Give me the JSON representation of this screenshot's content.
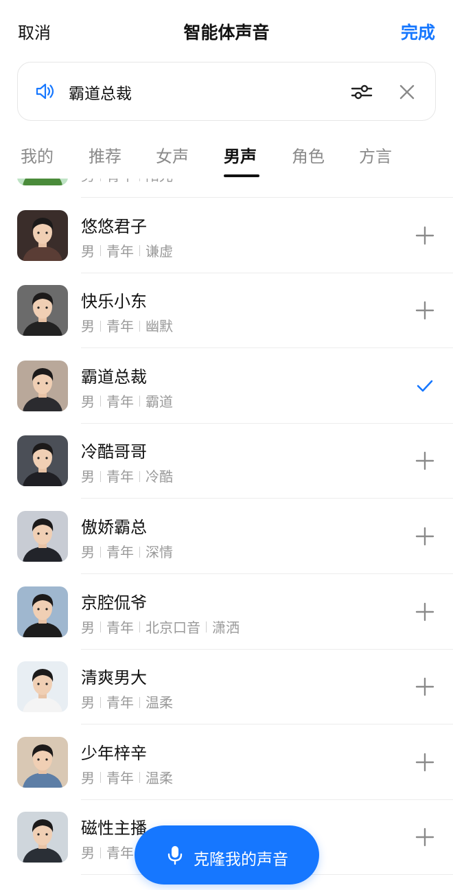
{
  "header": {
    "cancel_label": "取消",
    "title": "智能体声音",
    "done_label": "完成"
  },
  "selected_voice": {
    "name": "霸道总裁",
    "icons": [
      "speaker-icon",
      "sliders-icon",
      "close-icon"
    ]
  },
  "tabs": [
    {
      "label": "我的",
      "active": false
    },
    {
      "label": "推荐",
      "active": false
    },
    {
      "label": "女声",
      "active": false
    },
    {
      "label": "男声",
      "active": true
    },
    {
      "label": "角色",
      "active": false
    },
    {
      "label": "方言",
      "active": false
    }
  ],
  "voices": [
    {
      "name": "",
      "tags": [
        "男",
        "青年",
        "阳光"
      ],
      "selected": false,
      "avatar_bg": "#bfe3c5",
      "avatar_shirt": "#4a8b3a"
    },
    {
      "name": "悠悠君子",
      "tags": [
        "男",
        "青年",
        "谦虚"
      ],
      "selected": false,
      "avatar_bg": "#3a2d2a",
      "avatar_shirt": "#5a3d35"
    },
    {
      "name": "快乐小东",
      "tags": [
        "男",
        "青年",
        "幽默"
      ],
      "selected": false,
      "avatar_bg": "#6b6b6b",
      "avatar_shirt": "#222222"
    },
    {
      "name": "霸道总裁",
      "tags": [
        "男",
        "青年",
        "霸道"
      ],
      "selected": true,
      "avatar_bg": "#b9a89a",
      "avatar_shirt": "#2b2b2f"
    },
    {
      "name": "冷酷哥哥",
      "tags": [
        "男",
        "青年",
        "冷酷"
      ],
      "selected": false,
      "avatar_bg": "#4b4f57",
      "avatar_shirt": "#1f1f24"
    },
    {
      "name": "傲娇霸总",
      "tags": [
        "男",
        "青年",
        "深情"
      ],
      "selected": false,
      "avatar_bg": "#c8ccd4",
      "avatar_shirt": "#22242a"
    },
    {
      "name": "京腔侃爷",
      "tags": [
        "男",
        "青年",
        "北京口音",
        "潇洒"
      ],
      "selected": false,
      "avatar_bg": "#9fb7cf",
      "avatar_shirt": "#1d1d1d"
    },
    {
      "name": "清爽男大",
      "tags": [
        "男",
        "青年",
        "温柔"
      ],
      "selected": false,
      "avatar_bg": "#e8eef3",
      "avatar_shirt": "#f4f4f4"
    },
    {
      "name": "少年梓辛",
      "tags": [
        "男",
        "青年",
        "温柔"
      ],
      "selected": false,
      "avatar_bg": "#d9c8b4",
      "avatar_shirt": "#5d7ea6"
    },
    {
      "name": "磁性主播",
      "tags": [
        "男",
        "青年"
      ],
      "selected": false,
      "avatar_bg": "#cfd6dc",
      "avatar_shirt": "#2a2f36"
    }
  ],
  "clone_button": {
    "label": "克隆我的声音",
    "icon": "mic-icon"
  },
  "colors": {
    "accent": "#1677ff",
    "muted_text": "#9a9a9a",
    "divider": "#ececec"
  }
}
